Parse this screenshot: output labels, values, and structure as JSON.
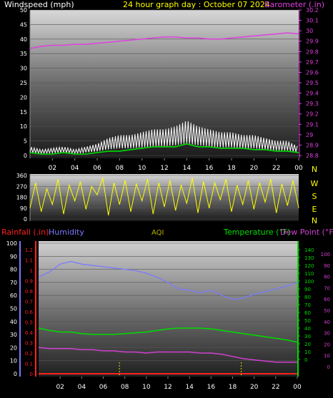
{
  "colors": {
    "windspeed": "#ffffff",
    "wind_avg": "#00dd00",
    "barometer": "#e040e0",
    "direction": "#ffff00",
    "rainfall": "#ff2020",
    "humidity": "#7a7aff",
    "aqi": "#b8b000",
    "temperature": "#00dd00",
    "dewpoint": "#d040d0",
    "time_axis": "#ffffff",
    "compass": "#ffff00"
  },
  "header": {
    "windspeed_label": "Windspeed (mph)",
    "title": "24 hour graph day : October 07 2024",
    "barometer_label": "Barometer (.in)"
  },
  "lower_header": {
    "rainfall_label": "Rainfall (.in)",
    "humidity_label": "Humidity",
    "aqi_label": "AQI",
    "temperature_label": "Temperature (°F)",
    "dewpoint_label": "Dew Point (°F)"
  },
  "compass_labels": [
    "N",
    "W",
    "S",
    "E",
    "N"
  ],
  "chart_data": [
    {
      "type": "line",
      "title": "24 hour graph day : October 07 2024",
      "x_ticks": [
        "02",
        "04",
        "06",
        "08",
        "10",
        "12",
        "14",
        "16",
        "18",
        "20",
        "22",
        "00"
      ],
      "xlim": [
        0,
        24
      ],
      "left_axis": {
        "label": "Windspeed (mph)",
        "ylim": [
          0,
          50
        ],
        "ticks": [
          "0",
          "5",
          "10",
          "15",
          "20",
          "25",
          "30",
          "35",
          "40",
          "45",
          "50"
        ]
      },
      "right_axis": {
        "label": "Barometer (.in)",
        "ylim": [
          28.8,
          30.2
        ],
        "ticks": [
          "28.8",
          "28.9",
          "29",
          "29.1",
          "29.2",
          "29.3",
          "29.4",
          "29.5",
          "29.6",
          "29.7",
          "29.8",
          "29.9",
          "30",
          "30.1",
          "30.2"
        ]
      },
      "grid": true,
      "series": [
        {
          "name": "Windspeed (mph)",
          "axis": "left",
          "x": [
            0,
            1,
            2,
            3,
            4,
            5,
            6,
            7,
            8,
            9,
            10,
            11,
            12,
            13,
            14,
            15,
            16,
            17,
            18,
            19,
            20,
            21,
            22,
            23,
            24
          ],
          "y": [
            3,
            2,
            2.5,
            3,
            2,
            3,
            4,
            6,
            7,
            7,
            8,
            9,
            9,
            10,
            12,
            10,
            9,
            8,
            8,
            7,
            7,
            6,
            5,
            5,
            3
          ]
        },
        {
          "axis": "left",
          "x": [
            0,
            1,
            2,
            3,
            4,
            5,
            6,
            7,
            8,
            9,
            10,
            11,
            12,
            13,
            14,
            15,
            16,
            17,
            18,
            19,
            20,
            21,
            22,
            23,
            24
          ],
          "y": [
            1,
            0.5,
            0.5,
            1,
            0.5,
            0.5,
            1,
            1.5,
            1.5,
            2,
            2.5,
            3,
            3,
            3,
            4,
            3,
            3,
            2.5,
            2.5,
            2.5,
            2,
            2,
            1.5,
            1.5,
            1
          ]
        },
        {
          "name": "Barometer (.in)",
          "axis": "right",
          "x": [
            0,
            1,
            2,
            3,
            4,
            5,
            6,
            7,
            8,
            9,
            10,
            11,
            12,
            13,
            14,
            15,
            16,
            17,
            18,
            19,
            20,
            21,
            22,
            23,
            24
          ],
          "y": [
            29.83,
            29.85,
            29.86,
            29.86,
            29.87,
            29.87,
            29.88,
            29.89,
            29.9,
            29.91,
            29.92,
            29.93,
            29.94,
            29.94,
            29.93,
            29.93,
            29.92,
            29.92,
            29.93,
            29.94,
            29.95,
            29.96,
            29.97,
            29.98,
            29.97
          ]
        }
      ]
    },
    {
      "type": "line",
      "x_ticks": [
        "02",
        "04",
        "06",
        "08",
        "10",
        "12",
        "14",
        "16",
        "18",
        "20",
        "22",
        "00"
      ],
      "xlim": [
        0,
        24
      ],
      "ylim": [
        0,
        360
      ],
      "y_ticks": [
        "0",
        "90",
        "180",
        "270",
        "360"
      ],
      "right_labels": [
        "N",
        "W",
        "S",
        "E",
        "N"
      ],
      "series": [
        {
          "axis": "left",
          "x": [
            0,
            0.5,
            1,
            1.5,
            2,
            2.5,
            3,
            3.5,
            4,
            4.5,
            5,
            5.5,
            6,
            6.5,
            7,
            7.5,
            8,
            8.5,
            9,
            9.5,
            10,
            10.5,
            11,
            11.5,
            12,
            12.5,
            13,
            13.5,
            14,
            14.5,
            15,
            15.5,
            16,
            16.5,
            17,
            17.5,
            18,
            18.5,
            19,
            19.5,
            20,
            20.5,
            21,
            21.5,
            22,
            22.5,
            23,
            23.5,
            24
          ],
          "y": [
            90,
            300,
            60,
            250,
            120,
            330,
            40,
            280,
            150,
            310,
            80,
            270,
            200,
            340,
            30,
            300,
            120,
            320,
            60,
            290,
            150,
            330,
            40,
            300,
            100,
            320,
            70,
            280,
            130,
            340,
            50,
            310,
            90,
            300,
            160,
            330,
            60,
            280,
            120,
            320,
            80,
            300,
            140,
            330,
            50,
            290,
            110,
            320,
            90
          ]
        }
      ]
    },
    {
      "type": "line",
      "x_ticks": [
        "02",
        "04",
        "06",
        "08",
        "10",
        "12",
        "14",
        "16",
        "18",
        "20",
        "22",
        "00"
      ],
      "xlim": [
        0,
        24
      ],
      "axes": {
        "humidity": {
          "label": "Humidity",
          "ylim": [
            0,
            100
          ],
          "ticks": [
            "0",
            "10",
            "20",
            "30",
            "40",
            "50",
            "60",
            "70",
            "80",
            "90",
            "100"
          ]
        },
        "rainfall": {
          "label": "Rainfall (.in)",
          "ylim": [
            0,
            1.2
          ],
          "ticks": [
            "0",
            "0.1",
            "0.2",
            "0.3",
            "0.4",
            "0.5",
            "0.6",
            "0.7",
            "0.8",
            "0.9",
            "1",
            "1.1",
            "1.2"
          ]
        },
        "temperature": {
          "label": "Temperature (°F)",
          "ylim": [
            0,
            140
          ],
          "ticks": [
            "0",
            "10",
            "20",
            "30",
            "40",
            "50",
            "60",
            "70",
            "80",
            "90",
            "100",
            "110",
            "120",
            "130",
            "140"
          ]
        },
        "dewpoint": {
          "label": "Dew Point (°F)",
          "ylim": [
            0,
            100
          ],
          "ticks": [
            "0",
            "10",
            "20",
            "30",
            "40",
            "50",
            "60",
            "70",
            "80",
            "90",
            "100"
          ]
        }
      },
      "series": [
        {
          "name": "Humidity",
          "axis": "humidity",
          "x": [
            0,
            1,
            2,
            3,
            4,
            5,
            6,
            7,
            8,
            9,
            10,
            11,
            12,
            13,
            14,
            15,
            16,
            17,
            18,
            19,
            20,
            21,
            22,
            23,
            24
          ],
          "y": [
            74,
            78,
            84,
            86,
            84,
            83,
            82,
            81,
            80,
            79,
            77,
            74,
            70,
            65,
            64,
            62,
            64,
            60,
            57,
            58,
            61,
            63,
            65,
            67,
            70
          ]
        },
        {
          "name": "Temperature (°F)",
          "axis": "temperature",
          "x": [
            0,
            1,
            2,
            3,
            4,
            5,
            6,
            7,
            8,
            9,
            10,
            11,
            12,
            13,
            14,
            15,
            16,
            17,
            18,
            19,
            20,
            21,
            22,
            23,
            24
          ],
          "y": [
            40,
            37,
            35,
            35,
            33,
            32,
            32,
            32,
            33,
            34,
            35,
            37,
            39,
            40,
            40,
            40,
            39,
            37,
            35,
            33,
            31,
            29,
            27,
            25,
            22
          ]
        },
        {
          "name": "Dew Point (°F)",
          "axis": "dewpoint",
          "x": [
            0,
            1,
            2,
            3,
            4,
            5,
            6,
            7,
            8,
            9,
            10,
            11,
            12,
            13,
            14,
            15,
            16,
            17,
            18,
            19,
            20,
            21,
            22,
            23,
            24
          ],
          "y": [
            17,
            16,
            16,
            16,
            15,
            15,
            14,
            14,
            13,
            13,
            12,
            13,
            13,
            13,
            13,
            12,
            12,
            11,
            9,
            7,
            6,
            5,
            4,
            4,
            4
          ]
        },
        {
          "name": "Rainfall (.in)",
          "axis": "rainfall",
          "x": [
            0,
            24
          ],
          "y": [
            0,
            0
          ]
        }
      ]
    }
  ]
}
